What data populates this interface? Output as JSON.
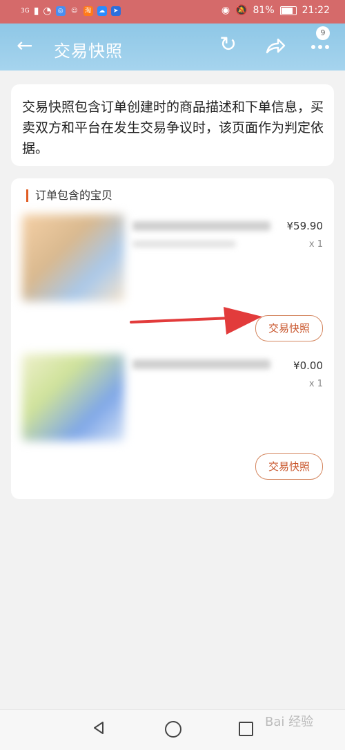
{
  "status_bar": {
    "network": "3G",
    "battery": "81%",
    "time": "21:22",
    "app_label": "淘"
  },
  "header": {
    "title": "交易快照",
    "badge_count": "9"
  },
  "info": {
    "text": "交易快照包含订单创建时的商品描述和下单信息，买卖双方和平台在发生交易争议时，该页面作为判定依据。"
  },
  "items_section": {
    "title": "订单包含的宝贝",
    "items": [
      {
        "price": "¥59.90",
        "qty": "x 1",
        "button_label": "交易快照"
      },
      {
        "price": "¥0.00",
        "qty": "x 1",
        "button_label": "交易快照"
      }
    ]
  },
  "colors": {
    "accent": "#e05c23",
    "status_bar": "#d56a6a",
    "header": "#8ec7e6"
  },
  "watermark": {
    "text": "Bai 经验"
  }
}
